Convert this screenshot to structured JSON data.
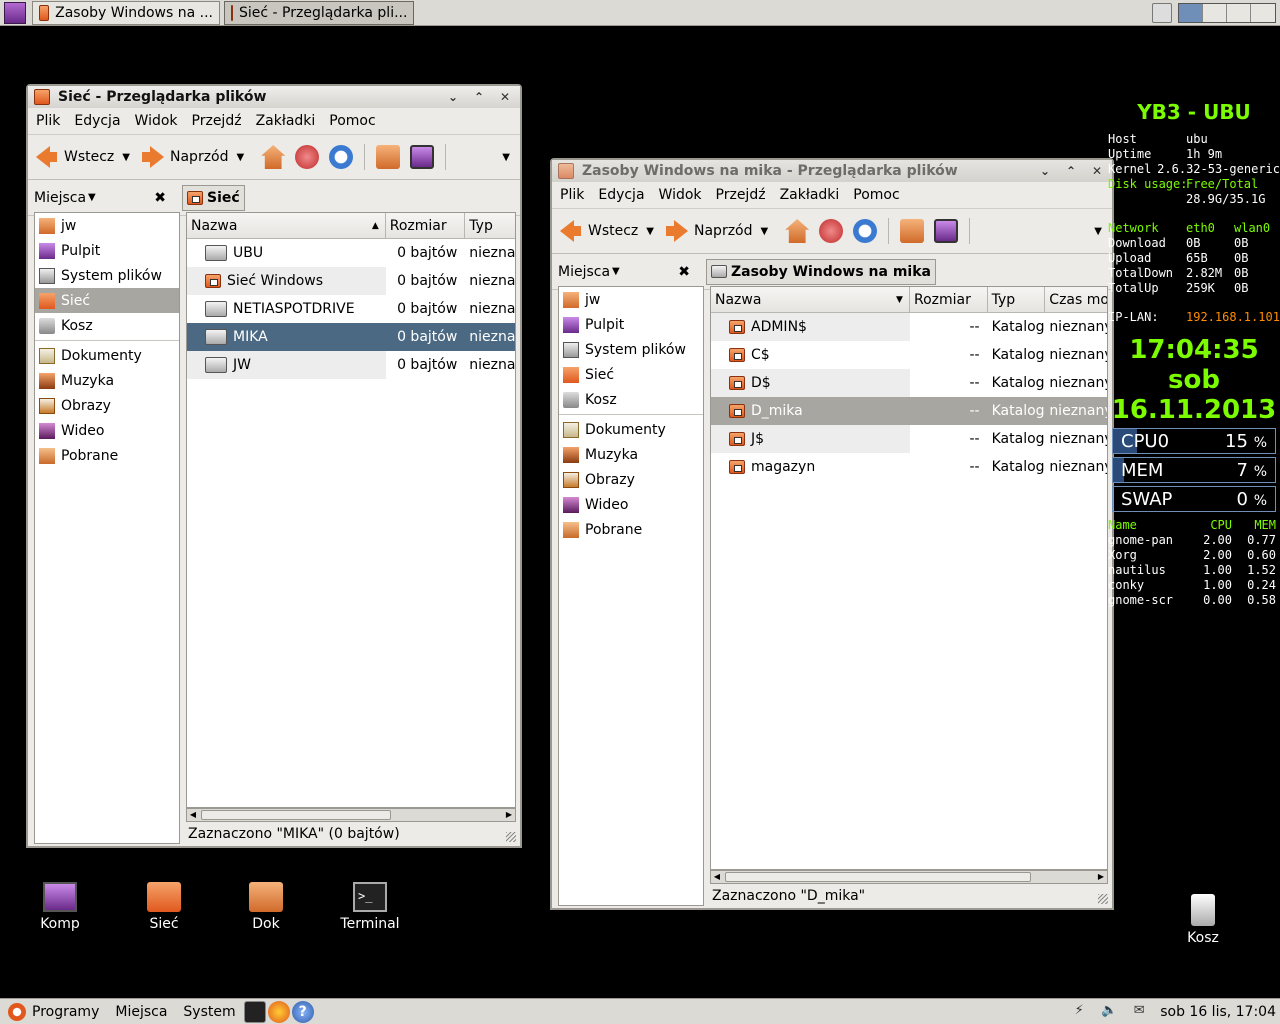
{
  "top_panel": {
    "tasks": [
      {
        "label": "Zasoby Windows na ...",
        "active": false
      },
      {
        "label": "Sieć - Przeglądarka pli...",
        "active": true
      }
    ]
  },
  "win1": {
    "title": "Sieć - Przeglądarka plików",
    "menu": [
      "Plik",
      "Edycja",
      "Widok",
      "Przejdź",
      "Zakładki",
      "Pomoc"
    ],
    "back": "Wstecz",
    "forward": "Naprzód",
    "places_label": "Miejsca",
    "crumb": "Sieć",
    "places": [
      "jw",
      "Pulpit",
      "System plików",
      "Sieć",
      "Kosz",
      "Dokumenty",
      "Muzyka",
      "Obrazy",
      "Wideo",
      "Pobrane"
    ],
    "columns": [
      "Nazwa",
      "Rozmiar",
      "Typ"
    ],
    "rows": [
      {
        "name": "UBU",
        "size": "0 bajtów",
        "type": "nieznany"
      },
      {
        "name": "Sieć Windows",
        "size": "0 bajtów",
        "type": "nieznany"
      },
      {
        "name": "NETIASPOTDRIVE",
        "size": "0 bajtów",
        "type": "nieznany"
      },
      {
        "name": "MIKA",
        "size": "0 bajtów",
        "type": "nieznany"
      },
      {
        "name": "JW",
        "size": "0 bajtów",
        "type": "nieznany"
      }
    ],
    "status": "Zaznaczono \"MIKA\" (0 bajtów)"
  },
  "win2": {
    "title": "Zasoby Windows na mika - Przeglądarka plików",
    "menu": [
      "Plik",
      "Edycja",
      "Widok",
      "Przejdź",
      "Zakładki",
      "Pomoc"
    ],
    "back": "Wstecz",
    "forward": "Naprzód",
    "places_label": "Miejsca",
    "crumb": "Zasoby Windows na mika",
    "places": [
      "jw",
      "Pulpit",
      "System plików",
      "Sieć",
      "Kosz",
      "Dokumenty",
      "Muzyka",
      "Obrazy",
      "Wideo",
      "Pobrane"
    ],
    "columns": [
      "Nazwa",
      "Rozmiar",
      "Typ",
      "Czas modyfikacji"
    ],
    "rows": [
      {
        "name": "ADMIN$",
        "size": "--",
        "type": "Katalog",
        "mtime": "nieznany"
      },
      {
        "name": "C$",
        "size": "--",
        "type": "Katalog",
        "mtime": "nieznany"
      },
      {
        "name": "D$",
        "size": "--",
        "type": "Katalog",
        "mtime": "nieznany"
      },
      {
        "name": "D_mika",
        "size": "--",
        "type": "Katalog",
        "mtime": "nieznany"
      },
      {
        "name": "J$",
        "size": "--",
        "type": "Katalog",
        "mtime": "nieznany"
      },
      {
        "name": "magazyn",
        "size": "--",
        "type": "Katalog",
        "mtime": "nieznany"
      }
    ],
    "status": "Zaznaczono \"D_mika\""
  },
  "desktop_icons": [
    "Komp",
    "Sieć",
    "Dok",
    "Terminal",
    "Kosz"
  ],
  "conky": {
    "title": "YB3 - UBU",
    "info": [
      {
        "k": "Host",
        "v": "ubu"
      },
      {
        "k": "Uptime",
        "v": "1h 9m"
      },
      {
        "k": "Kernel",
        "v": "2.6.32-53-generic"
      },
      {
        "k": "Disk usage:",
        "v": "Free/Total"
      },
      {
        "k": "",
        "v": "28.9G/35.1G"
      }
    ],
    "net_hdr": {
      "k": "Network",
      "a": "eth0",
      "b": "wlan0"
    },
    "net": [
      {
        "k": "Download",
        "a": "0B",
        "b": "0B"
      },
      {
        "k": "Upload",
        "a": "65B",
        "b": "0B"
      },
      {
        "k": "TotalDown",
        "a": "2.82M",
        "b": "0B"
      },
      {
        "k": "TotalUp",
        "a": "259K",
        "b": "0B"
      }
    ],
    "ip_label": "IP-LAN:",
    "ip": "192.168.1.101",
    "time": "17:04:35",
    "day": "sob",
    "date": "16.11.2013",
    "bars": [
      {
        "label": "CPU0",
        "value": "15",
        "unit": "%",
        "pct": 15
      },
      {
        "label": "MEM",
        "value": "7",
        "unit": "%",
        "pct": 7
      },
      {
        "label": "SWAP",
        "value": "0",
        "unit": "%",
        "pct": 0
      }
    ],
    "proc_hdr": [
      "Name",
      "CPU",
      "MEM"
    ],
    "procs": [
      [
        "gnome-pan",
        "2.00",
        "0.77"
      ],
      [
        "Xorg",
        "2.00",
        "0.60"
      ],
      [
        "nautilus",
        "1.00",
        "1.52"
      ],
      [
        "conky",
        "1.00",
        "0.24"
      ],
      [
        "gnome-scr",
        "0.00",
        "0.58"
      ]
    ]
  },
  "bottom_panel": {
    "menus": [
      "Programy",
      "Miejsca",
      "System"
    ],
    "clock": "sob 16 lis, 17:04"
  }
}
